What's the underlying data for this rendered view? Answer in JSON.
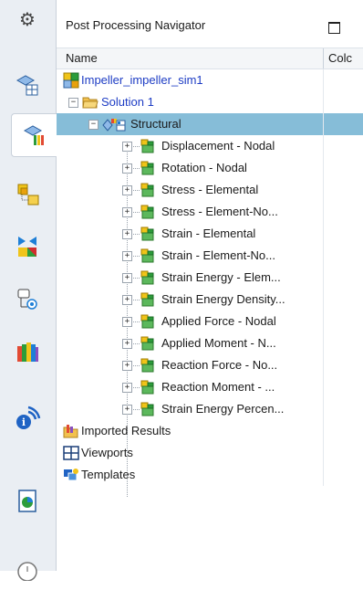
{
  "navigator": {
    "title": "Post Processing Navigator",
    "columns": {
      "name": "Name",
      "color": "Colc"
    }
  },
  "tree": {
    "root": "Impeller_impeller_sim1",
    "solution": "Solution 1",
    "structural": "Structural",
    "results": [
      "Displacement - Nodal",
      "Rotation - Nodal",
      "Stress - Elemental",
      "Stress - Element-No...",
      "Strain - Elemental",
      "Strain - Element-No...",
      "Strain Energy - Elem...",
      "Strain Energy Density...",
      "Applied Force - Nodal",
      "Applied Moment - N...",
      "Reaction Force - No...",
      "Reaction Moment - ...",
      "Strain Energy Percen..."
    ],
    "imported_results": "Imported Results",
    "viewports": "Viewports",
    "templates": "Templates"
  },
  "toggles": {
    "collapse": "−",
    "expand": "+"
  },
  "icons": {
    "leftbar": [
      "gear-icon",
      "sim-navigator-icon",
      "post-processing-navigator-icon",
      "fem-icon",
      "assembly-fem-icon",
      "constraint-icon",
      "history-icon",
      "roles-library-icon",
      "info-icon",
      "report-icon",
      "clock-icon"
    ],
    "selected_row_color": "#86bdd8",
    "link_color": "#1d3cc4"
  }
}
